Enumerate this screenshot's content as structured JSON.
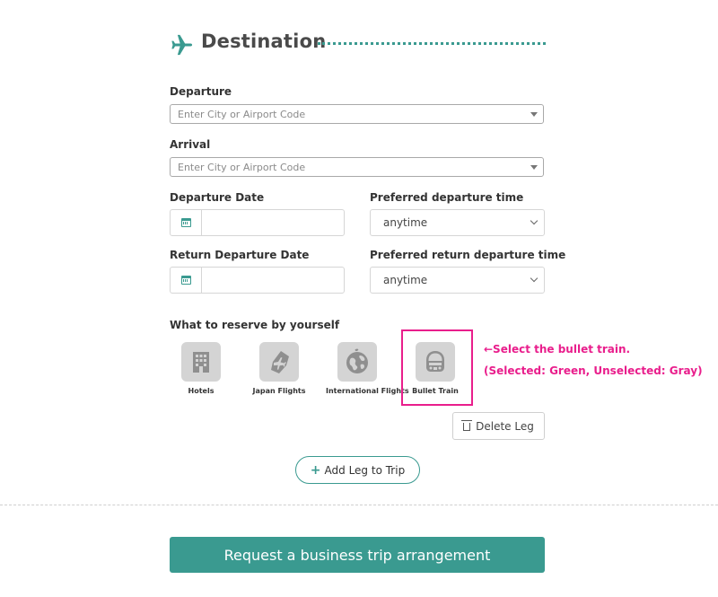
{
  "section": {
    "title": "Destination",
    "accent_color": "#3a9a90",
    "icon": "airplane-icon"
  },
  "departure": {
    "label": "Departure",
    "placeholder": "Enter City or Airport Code"
  },
  "arrival": {
    "label": "Arrival",
    "placeholder": "Enter City or Airport Code"
  },
  "departure_date": {
    "label": "Departure Date",
    "value": ""
  },
  "preferred_departure_time": {
    "label": "Preferred departure time",
    "value": "anytime"
  },
  "return_date": {
    "label": "Return Departure Date",
    "value": ""
  },
  "preferred_return_time": {
    "label": "Preferred return departure time",
    "value": "anytime"
  },
  "reserve": {
    "label": "What to reserve by yourself",
    "items": [
      {
        "label": "Hotels",
        "icon": "hotel-icon",
        "selected": false
      },
      {
        "label": "Japan Flights",
        "icon": "japan-map-plane-icon",
        "selected": false
      },
      {
        "label": "International Flights",
        "icon": "globe-icon",
        "selected": false
      },
      {
        "label": "Bullet Train",
        "icon": "bullet-train-icon",
        "selected": false
      }
    ]
  },
  "annotation": {
    "line1": "←Select the bullet train.",
    "line2": "(Selected: Green, Unselected: Gray)",
    "color": "#e91e8c"
  },
  "delete_leg": {
    "label": "Delete Leg"
  },
  "add_leg": {
    "label": "Add Leg to Trip"
  },
  "submit": {
    "label": "Request a business trip arrangement"
  }
}
